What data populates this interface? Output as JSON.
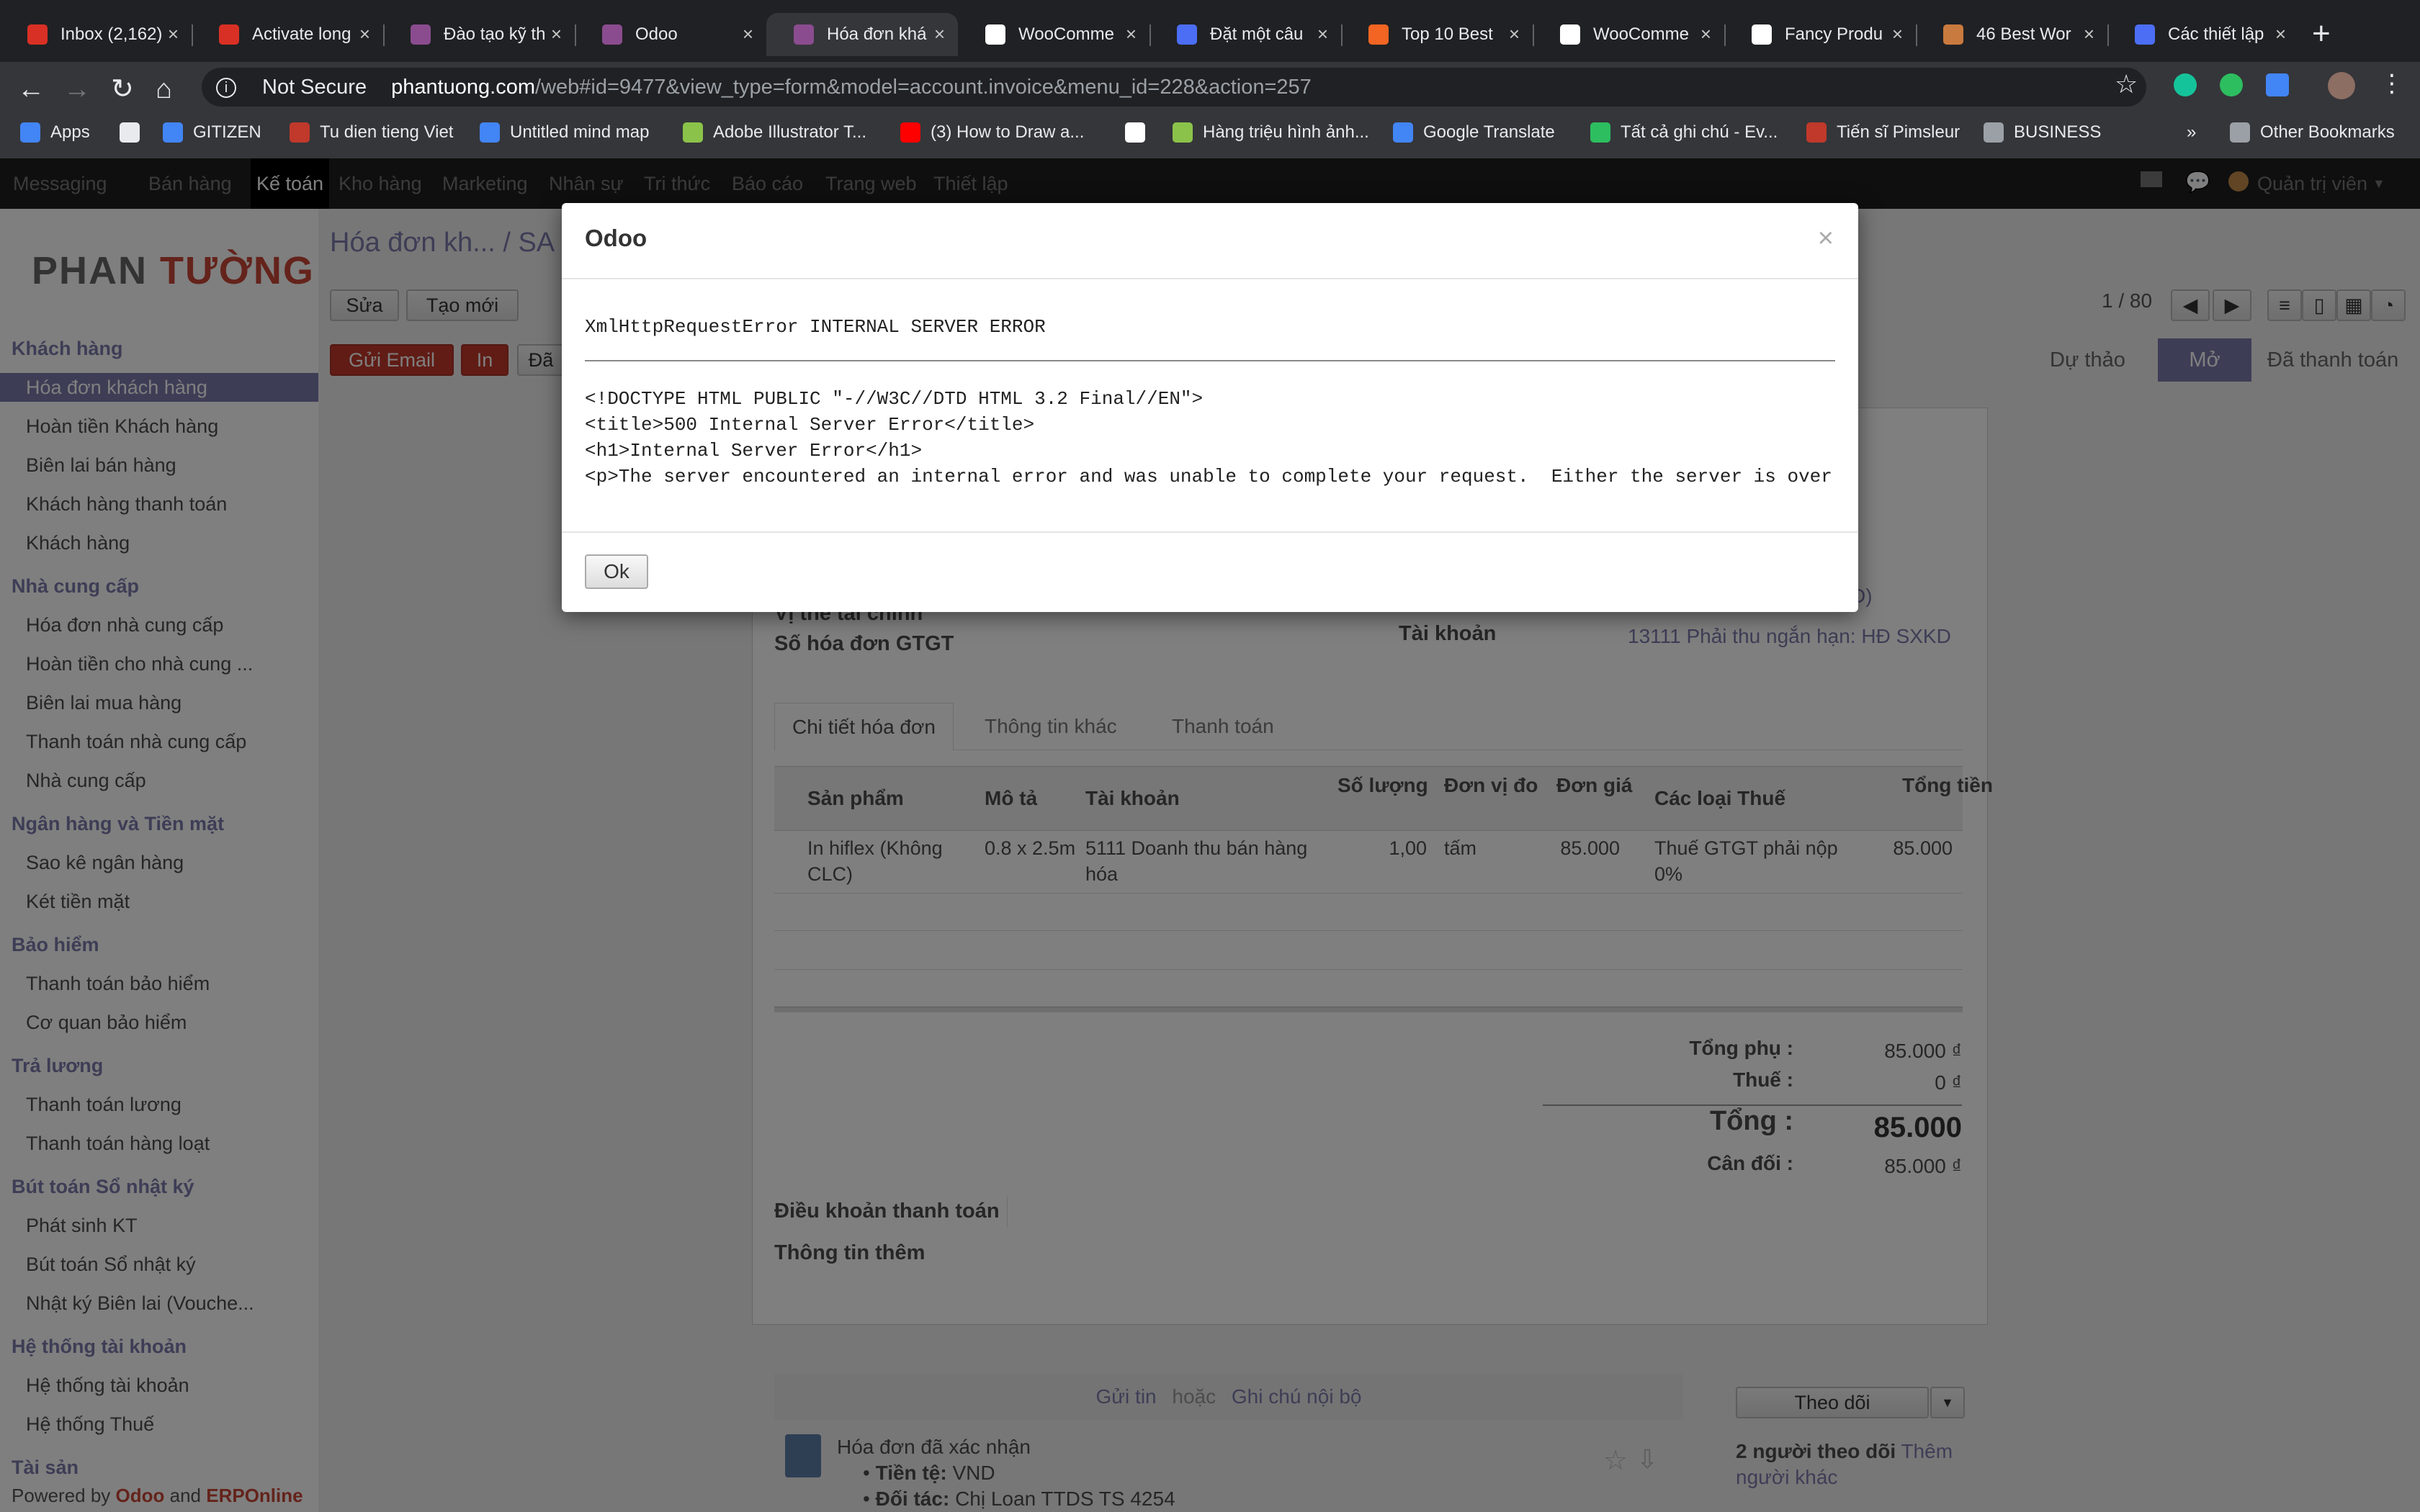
{
  "browser": {
    "tabs": [
      {
        "title": "Inbox (2,162)",
        "color": "#d93025"
      },
      {
        "title": "Activate long",
        "color": "#d93025"
      },
      {
        "title": "Đào tạo kỹ th",
        "color": "#8a4c8e"
      },
      {
        "title": "Odoo",
        "color": "#8a4c8e"
      },
      {
        "title": "Hóa đơn khá",
        "color": "#8a4c8e"
      },
      {
        "title": "WooComme",
        "color": "#ffffff"
      },
      {
        "title": "Đặt một câu",
        "color": "#4c6ef5"
      },
      {
        "title": "Top 10 Best",
        "color": "#f26522"
      },
      {
        "title": "WooComme",
        "color": "#ffffff"
      },
      {
        "title": "Fancy Produ",
        "color": "#ffffff"
      },
      {
        "title": "46 Best Wor",
        "color": "#c97a3e"
      },
      {
        "title": "Các thiết lập",
        "color": "#4c6ef5"
      }
    ],
    "not_secure": "Not Secure",
    "url_host": "phantuong.com",
    "url_path": "/web#id=9477&view_type=form&model=account.invoice&menu_id=228&action=257",
    "bookmarks": [
      {
        "label": "Apps",
        "color": "#4285f4"
      },
      {
        "label": "",
        "color": "#e8eaed"
      },
      {
        "label": "GITIZEN",
        "color": "#4285f4"
      },
      {
        "label": "Tu dien tieng Viet",
        "color": "#c0392b"
      },
      {
        "label": "Untitled mind map",
        "color": "#4285f4"
      },
      {
        "label": "Adobe Illustrator T...",
        "color": "#8bc34a"
      },
      {
        "label": "(3) How to Draw a...",
        "color": "#ff0000"
      },
      {
        "label": "",
        "color": "#ffffff"
      },
      {
        "label": "Hàng triệu hình ảnh...",
        "color": "#8bc34a"
      },
      {
        "label": "Google Translate",
        "color": "#4285f4"
      },
      {
        "label": "Tất cả ghi chú - Ev...",
        "color": "#2dbe60"
      },
      {
        "label": "Tiến sĩ Pimsleur",
        "color": "#c0392b"
      },
      {
        "label": "BUSINESS",
        "color": "#9aa0a6"
      }
    ],
    "more": "»",
    "other_bookmarks": "Other Bookmarks"
  },
  "odoo": {
    "menu": [
      "Messaging",
      "Bán hàng",
      "Kế toán",
      "Kho hàng",
      "Marketing",
      "Nhân sự",
      "Tri thức",
      "Báo cáo",
      "Trang web",
      "Thiết lập"
    ],
    "active_menu": "Kế toán",
    "user": "Quản trị viên",
    "logo_left": "PHAN ",
    "logo_right": "TƯỜNG",
    "sidebar": [
      {
        "section": "Khách hàng",
        "items": [
          "Hóa đơn khách hàng",
          "Hoàn tiền Khách hàng",
          "Biên lai bán hàng",
          "Khách hàng thanh toán",
          "Khách hàng"
        ]
      },
      {
        "section": "Nhà cung cấp",
        "items": [
          "Hóa đơn nhà cung cấp",
          "Hoàn tiền cho nhà cung ...",
          "Biên lai mua hàng",
          "Thanh toán nhà cung cấp",
          "Nhà cung cấp"
        ]
      },
      {
        "section": "Ngân hàng và Tiền mặt",
        "items": [
          "Sao kê ngân hàng",
          "Két tiền mặt"
        ]
      },
      {
        "section": "Bảo hiểm",
        "items": [
          "Thanh toán bảo hiểm",
          "Cơ quan bảo hiểm"
        ]
      },
      {
        "section": "Trả lương",
        "items": [
          "Thanh toán lương",
          "Thanh toán hàng loạt"
        ]
      },
      {
        "section": "Bút toán Sổ nhật ký",
        "items": [
          "Phát sinh KT",
          "Bút toán Sổ nhật ký",
          "Nhật ký Biên lai (Vouche..."
        ]
      },
      {
        "section": "Hệ thống tài khoản",
        "items": [
          "Hệ thống tài khoản",
          "Hệ thống Thuế"
        ]
      },
      {
        "section": "Tài sản",
        "items": []
      }
    ],
    "powered": {
      "prefix": "Powered by ",
      "odoo": "Odoo",
      "and": " and ",
      "erp": "ERPOnline"
    },
    "breadcrumb": "Hóa đơn kh... / SA",
    "buttons": {
      "edit": "Sửa",
      "create": "Tạo mới",
      "send_email": "Gửi Email",
      "print": "In",
      "more": "Đã"
    },
    "pager": "1 / 80",
    "status": [
      "Dự thảo",
      "Mở",
      "Đã thanh toán"
    ],
    "form": {
      "fiscal_label": "Vị thế tài chính",
      "vat_label": "Số hóa đơn GTGT",
      "account_label": "Tài khoản",
      "account_value": "13111 Phải thu ngắn hạn: HĐ SXKD",
      "account_suffix": "D)",
      "tabs": [
        "Chi tiết hóa đơn",
        "Thông tin khác",
        "Thanh toán"
      ],
      "columns": [
        "Sản phẩm",
        "Mô tả",
        "Tài khoản",
        "Số lượng",
        "Đơn vị đo",
        "Đơn giá",
        "Các loại Thuế",
        "Tổng tiền"
      ],
      "rows": [
        {
          "product": "In hiflex (Không CLC)",
          "desc": "0.8 x 2.5m",
          "account": "5111 Doanh thu bán hàng hóa",
          "qty": "1,00",
          "uom": "tấm",
          "price": "85.000",
          "taxes": "Thuế GTGT phải nộp 0%",
          "total": "85.000"
        }
      ],
      "subtotal_label": "Tổng phụ :",
      "subtotal": "85.000 ₫",
      "tax_label": "Thuế :",
      "tax": "0 ₫",
      "total_label": "Tổng :",
      "total": "85.000",
      "balance_label": "Cân đối :",
      "balance": "85.000 ₫",
      "payment_terms": "Điều khoản thanh toán",
      "more_info": "Thông tin thêm"
    },
    "chatter": {
      "send": "Gửi tin",
      "or": "hoặc",
      "note": "Ghi chú nội bộ",
      "follow": "Theo dõi",
      "followers": "2 người theo dõi",
      "add": "Thêm người khác",
      "msg_title": "Hóa đơn đã xác nhận",
      "currency_label": "Tiền tệ:",
      "currency": "VND",
      "partner_label": "Đối tác:",
      "partner": "Chị Loan TTDS TS 4254"
    }
  },
  "dialog": {
    "title": "Odoo",
    "close": "×",
    "error": "XmlHttpRequestError INTERNAL SERVER ERROR",
    "lines": [
      "<!DOCTYPE HTML PUBLIC \"-//W3C//DTD HTML 3.2 Final//EN\">",
      "<title>500 Internal Server Error</title>",
      "<h1>Internal Server Error</h1>",
      "<p>The server encountered an internal error and was unable to complete your request.  Either the server is over"
    ],
    "ok": "Ok"
  }
}
